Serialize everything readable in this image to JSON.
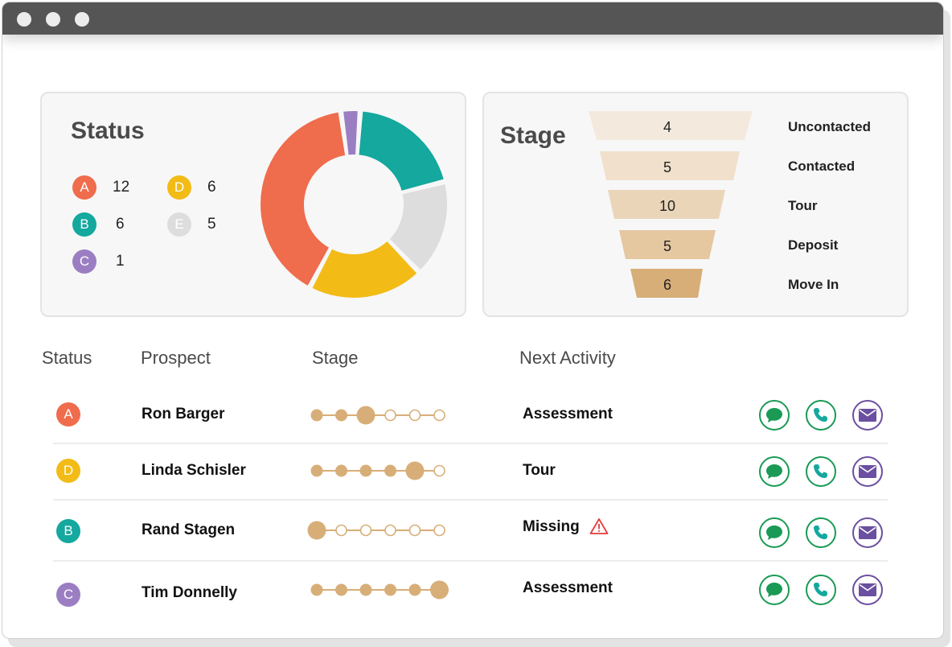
{
  "colors": {
    "A": "#ef6c4c",
    "B": "#14a89e",
    "C": "#9b7ec2",
    "D": "#f2bb16",
    "E": "#dddddd",
    "stage": "#d8ae78",
    "chat_green": "#1a9a55",
    "phone_teal": "#14a89e",
    "mail_purple": "#6b4fa0",
    "warning_red": "#e53b3b"
  },
  "status_card": {
    "title": "Status",
    "legend": [
      {
        "letter": "A",
        "count": "12"
      },
      {
        "letter": "B",
        "count": "6"
      },
      {
        "letter": "C",
        "count": "1"
      },
      {
        "letter": "D",
        "count": "6"
      },
      {
        "letter": "E",
        "count": "5"
      }
    ]
  },
  "chart_data": {
    "type": "pie",
    "categories": [
      "C",
      "B",
      "E",
      "D",
      "A"
    ],
    "values": [
      1,
      6,
      5,
      6,
      12
    ],
    "title": "Status",
    "donut": true
  },
  "stage_card": {
    "title": "Stage",
    "funnel": [
      {
        "label": "Uncontacted",
        "value": "4"
      },
      {
        "label": "Contacted",
        "value": "5"
      },
      {
        "label": "Tour",
        "value": "10"
      },
      {
        "label": "Deposit",
        "value": "5"
      },
      {
        "label": "Move In",
        "value": "6"
      }
    ]
  },
  "table": {
    "headers": {
      "status": "Status",
      "prospect": "Prospect",
      "stage": "Stage",
      "next_activity": "Next Activity"
    },
    "rows": [
      {
        "status": "A",
        "prospect": "Ron Barger",
        "stage": 3,
        "stages_total": 6,
        "activity": "Assessment",
        "warning": false
      },
      {
        "status": "D",
        "prospect": "Linda Schisler",
        "stage": 5,
        "stages_total": 6,
        "activity": "Tour",
        "warning": false
      },
      {
        "status": "B",
        "prospect": "Rand Stagen",
        "stage": 1,
        "stages_total": 6,
        "activity": "Missing",
        "warning": true
      },
      {
        "status": "C",
        "prospect": "Tim Donnelly",
        "stage": 6,
        "stages_total": 6,
        "activity": "Assessment",
        "warning": false
      }
    ]
  },
  "icons": {
    "chat": "chat-bubble-icon",
    "phone": "phone-icon",
    "mail": "envelope-icon",
    "warning": "warning-triangle-icon"
  }
}
